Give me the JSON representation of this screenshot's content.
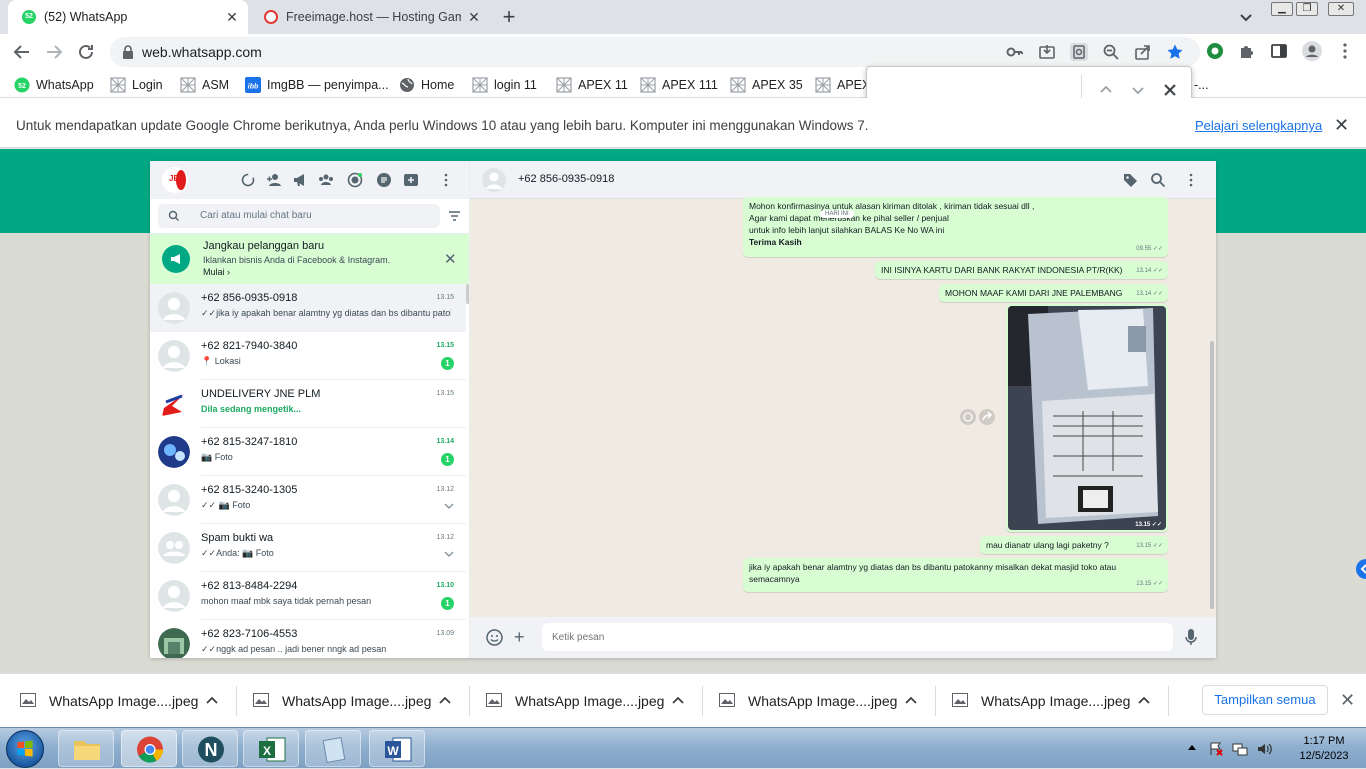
{
  "browser": {
    "tabs": [
      {
        "title": "(52) WhatsApp",
        "favicon_badge": "52",
        "active": true
      },
      {
        "title": "Freeimage.host — Hosting Gamb",
        "active": false
      }
    ],
    "url": "web.whatsapp.com",
    "bookmarks": [
      {
        "label": "WhatsApp",
        "icon": "whatsapp-icon"
      },
      {
        "label": "Login",
        "icon": "page-icon"
      },
      {
        "label": "ASM",
        "icon": "page-icon"
      },
      {
        "label": "ImgBB — penyimpa...",
        "icon": "imgbb-icon"
      },
      {
        "label": "Home",
        "icon": "globe-icon"
      },
      {
        "label": "login 11",
        "icon": "page-icon"
      },
      {
        "label": "APEX 11",
        "icon": "page-icon"
      },
      {
        "label": "APEX 111",
        "icon": "page-icon"
      },
      {
        "label": "APEX 35",
        "icon": "page-icon"
      },
      {
        "label": "APEX",
        "icon": "page-icon"
      }
    ],
    "bookmark_overflow": "-...",
    "find_bar": {
      "value": ""
    },
    "infobar": {
      "text": "Untuk mendapatkan update Google Chrome berikutnya, Anda perlu Windows 10 atau yang lebih baru. Komputer ini menggunakan Windows 7.",
      "link": "Pelajari selengkapnya"
    },
    "accent": "#1a73e8"
  },
  "whatsapp": {
    "accent": "#00a884",
    "search_placeholder": "Cari atau mulai chat baru",
    "promo": {
      "title": "Jangkau pelanggan baru",
      "subtitle": "Iklankan bisnis Anda di Facebook & Instagram.",
      "cta": "Mulai ›"
    },
    "chats": [
      {
        "name": "+62 856-0935-0918",
        "time": "13.15",
        "preview": "✓✓jika iy  apakah benar alamtny  yg diatas dan  bs dibantu patokanny misalkan dekat masjid toko atau semacamnya",
        "selected": true
      },
      {
        "name": "+62 821-7940-3840",
        "time": "13.15",
        "preview": "📍 Lokasi",
        "badge": "1"
      },
      {
        "name": "UNDELIVERY JNE PLM",
        "time": "13.15",
        "preview": "Dila sedang mengetik...",
        "typing": true
      },
      {
        "name": "+62 815-3247-1810",
        "time": "13.14",
        "preview": "📷 Foto",
        "badge": "1"
      },
      {
        "name": "+62 815-3240-1305",
        "time": "13.12",
        "preview": "✓✓ 📷 Foto",
        "chevron": true
      },
      {
        "name": "Spam bukti wa",
        "time": "13.12",
        "preview": "✓✓Anda: 📷 Foto",
        "chevron": true
      },
      {
        "name": "+62 813-8484-2294",
        "time": "13.10",
        "preview": "mohon maaf mbk saya tidak pernah pesan",
        "badge": "1"
      },
      {
        "name": "+62 823-7106-4553",
        "time": "13.09",
        "preview": "✓✓nggk ad  pesan      .. jadi  bener      nngk ad  pesan"
      }
    ],
    "active_chat": {
      "name": "+62 856-0935-0918",
      "day_chip": "HARI INI",
      "messages": [
        {
          "lines": [
            "Mohon konfirmasinya untuk alasan kiriman ditolak , kiriman tidak sesuai dll ,",
            "Agar kami dapat meneruskan ke pihal seller / penjual",
            "untuk info lebih lanjut silahkan BALAS Ke No WA ini",
            "Terima Kasih"
          ],
          "time": "09.55 ✓✓"
        },
        {
          "text": "INI ISINYA KARTU DARI  BANK RAKYAT INDONESIA PT/R(KK)",
          "time": "13.14 ✓✓"
        },
        {
          "text": "MOHON MAAF KAMI DARI JNE PALEMBANG",
          "time": "13.14 ✓✓"
        },
        {
          "image": "package-photo",
          "time": "13.15 ✓✓"
        },
        {
          "text": "mau dianatr ulang    lagi  paketny ?",
          "time": "13.15 ✓✓"
        },
        {
          "text": "jika iy  apakah benar alamtny  yg diatas dan  bs dibantu patokanny misalkan dekat masjid toko atau semacamnya",
          "time": "13.15 ✓✓"
        }
      ],
      "composer_placeholder": "Ketik pesan"
    }
  },
  "downloads": {
    "items": [
      "WhatsApp Image....jpeg",
      "WhatsApp Image....jpeg",
      "WhatsApp Image....jpeg",
      "WhatsApp Image....jpeg",
      "WhatsApp Image....jpeg"
    ],
    "show_all": "Tampilkan semua"
  },
  "taskbar": {
    "apps": [
      "file-explorer",
      "chrome",
      "n-app",
      "excel",
      "notepad",
      "word"
    ],
    "time": "1:17 PM",
    "date": "12/5/2023"
  }
}
